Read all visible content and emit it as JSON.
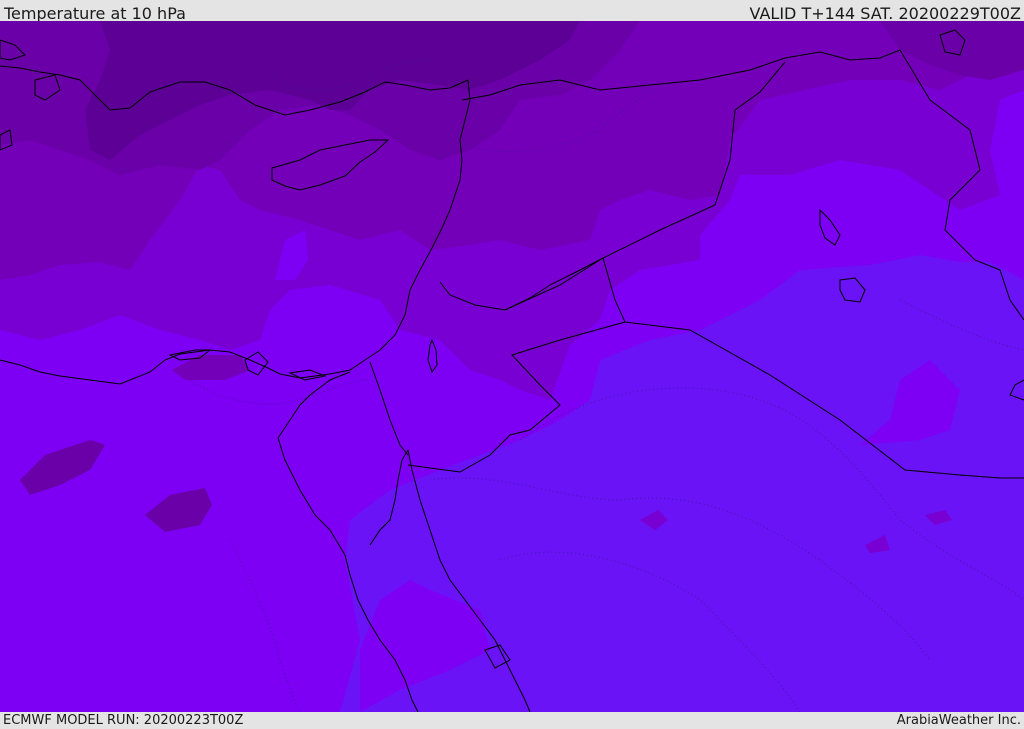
{
  "header": {
    "title": "Temperature at 10 hPa",
    "valid": "VALID T+144 SAT. 20200229T00Z"
  },
  "footer": {
    "model_run": "ECMWF MODEL RUN: 20200223T00Z",
    "credit": "ArabiaWeather Inc."
  },
  "map": {
    "field": "temperature",
    "level": "10 hPa",
    "shading_colors": [
      "#5c0096",
      "#6a00a8",
      "#7300b8",
      "#7800d2",
      "#7d00f5",
      "#6a13f7"
    ],
    "border_color": "#000000"
  }
}
